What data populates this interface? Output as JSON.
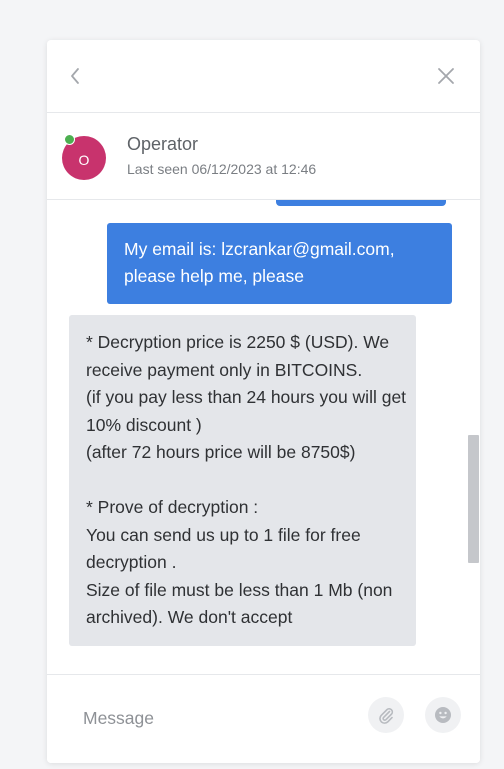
{
  "header": {
    "operator_name": "Operator",
    "last_seen": "Last seen 06/12/2023 at 12:46",
    "avatar_initial": "O"
  },
  "messages": {
    "outgoing_text": "My email is: lzcrankar@gmail.com, please help me, please",
    "incoming_text": "* Decryption price is 2250 $ (USD). We receive payment only in BITCOINS.\n(if you pay less than 24 hours you will get 10% discount )\n(after 72 hours price will be 8750$)\n\n* Prove of decryption :\nYou can send us up to 1 file for free decryption .\nSize of file must be less than 1 Mb (non archived). We don't accept"
  },
  "composer": {
    "placeholder": "Message"
  },
  "icons": {
    "back": "chevron-left-icon",
    "close": "close-icon",
    "attach": "paperclip-icon",
    "emoji": "smiley-icon"
  },
  "colors": {
    "outgoing_bubble": "#3d7fe0",
    "incoming_bubble": "#e4e6ea",
    "avatar": "#c8336d",
    "online": "#4caf50"
  }
}
